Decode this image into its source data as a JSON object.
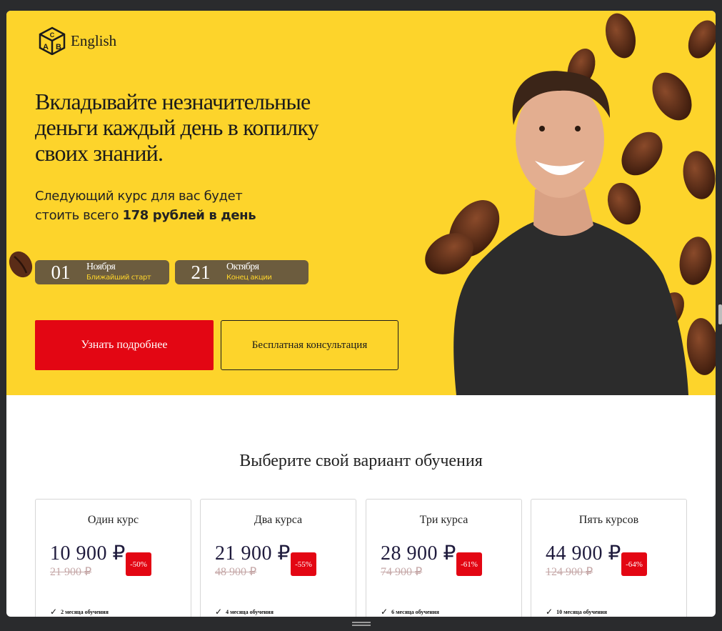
{
  "header": {
    "logo_icon": "abc-cube-icon",
    "language": "English"
  },
  "hero": {
    "title": "Вкладывайте незначительные деньги каждый день в копилку своих знаний.",
    "subtitle_prefix": "Следующий курс для вас будет стоить всего ",
    "subtitle_bold": "178 рублей в день",
    "dates": [
      {
        "day": "01",
        "month": "Ноября",
        "note": "Ближайший старт"
      },
      {
        "day": "21",
        "month": "Октября",
        "note": "Конец акции"
      }
    ],
    "primary_button": "Узнать подробнее",
    "secondary_button": "Бесплатная консультация",
    "accent_color": "#fdd42b",
    "cta_color": "#e30613"
  },
  "plans": {
    "title": "Выберите свой вариант обучения",
    "cards": [
      {
        "name": "Один курс",
        "price": "10 900 ₽",
        "old_price": "21 900 ₽",
        "discount": "-50%",
        "feature": "2 месяца обучения"
      },
      {
        "name": "Два курса",
        "price": "21 900 ₽",
        "old_price": "48 900 ₽",
        "discount": "-55%",
        "feature": "4 месяца обучения"
      },
      {
        "name": "Три курса",
        "price": "28 900 ₽",
        "old_price": "74 900 ₽",
        "discount": "-61%",
        "feature": "6 месяца обучения"
      },
      {
        "name": "Пять курсов",
        "price": "44 900 ₽",
        "old_price": "124 900 ₽",
        "discount": "-64%",
        "feature": "10 месяца обучения"
      }
    ]
  }
}
